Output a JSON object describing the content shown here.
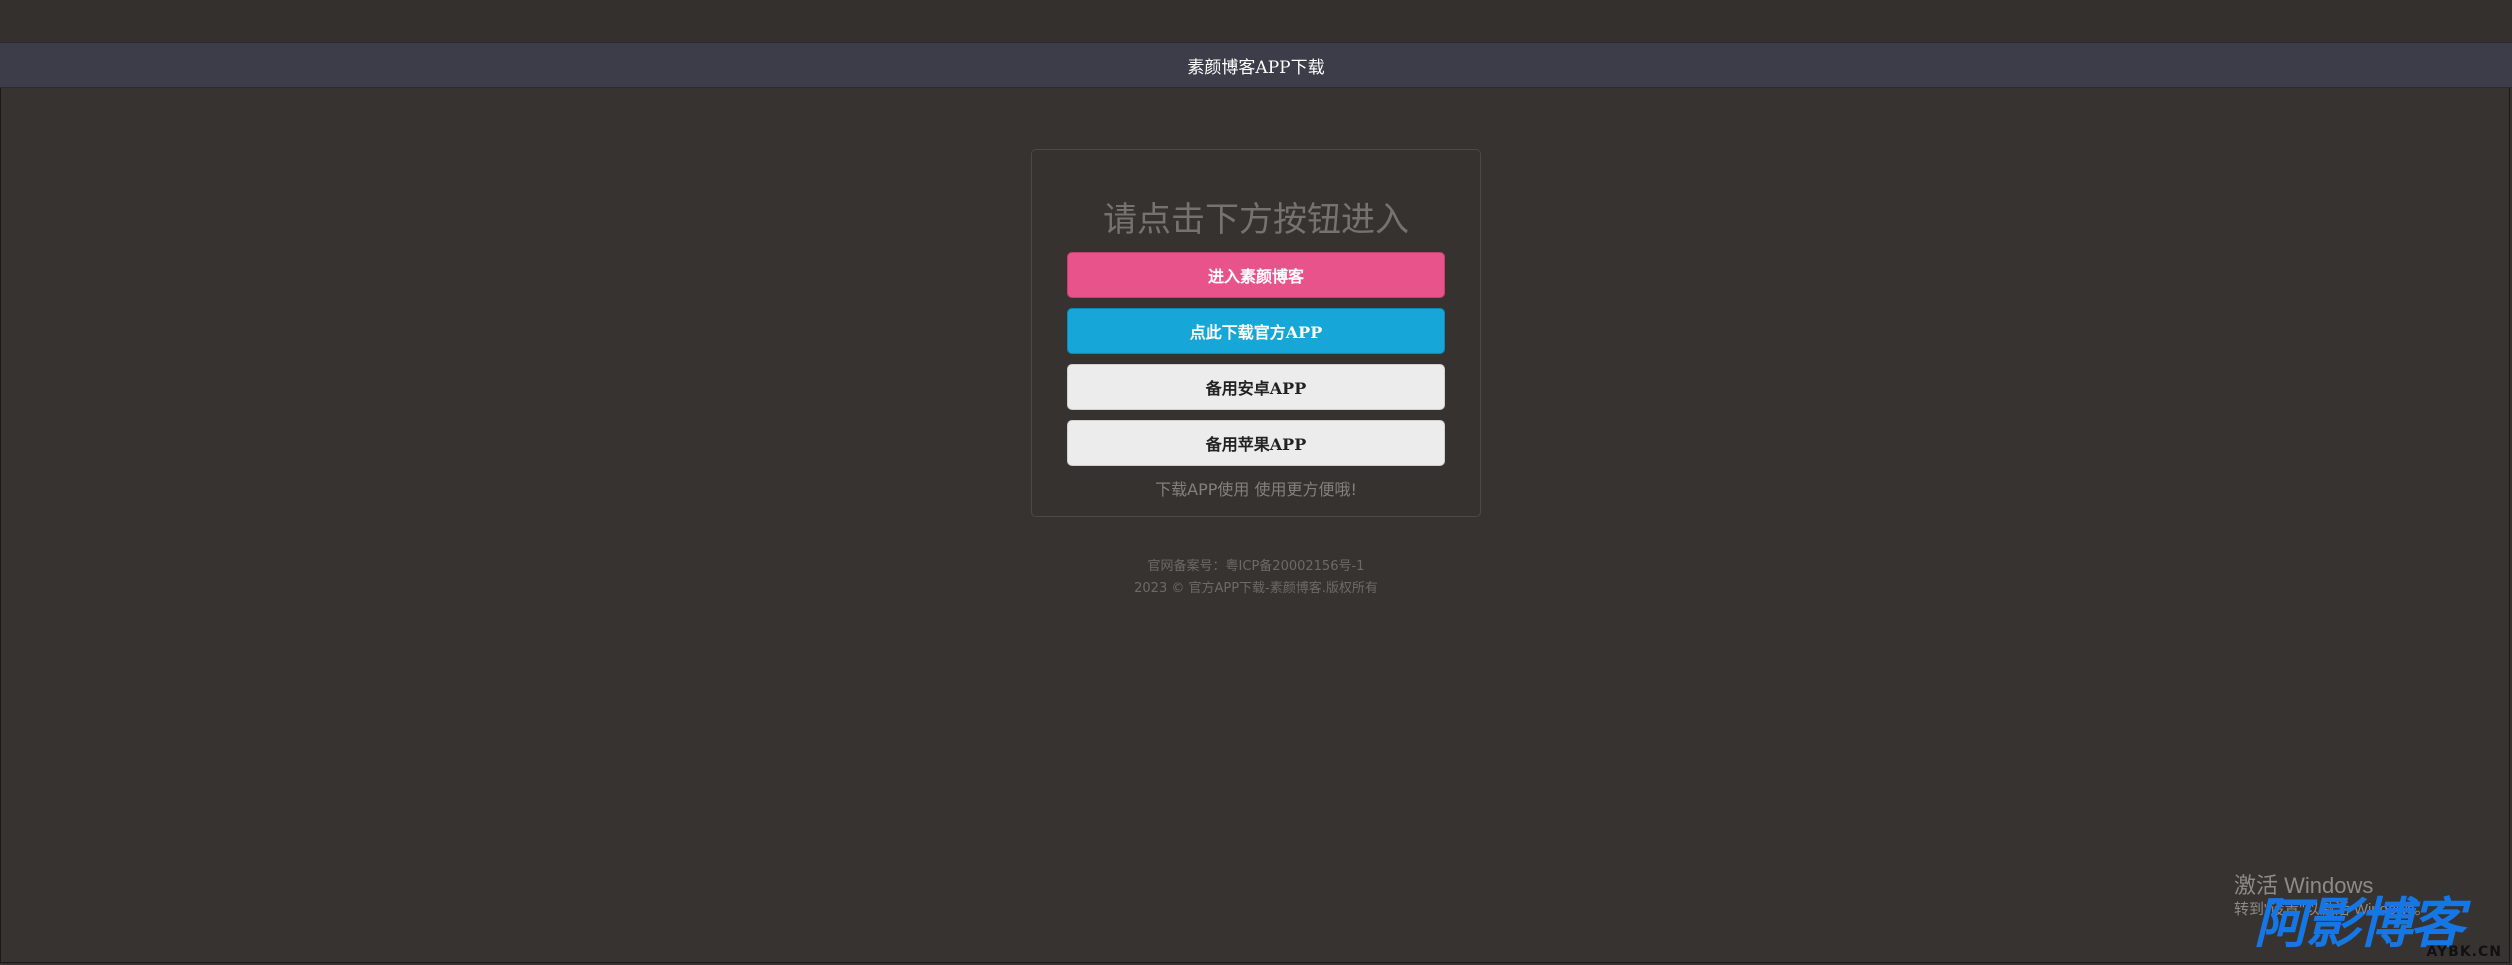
{
  "header": {
    "title": "素颜博客APP下载"
  },
  "card": {
    "heading": "请点击下方按钮进入",
    "buttons": [
      {
        "label": "进入素颜博客",
        "color": "#e9538c"
      },
      {
        "label": "点此下载官方APP",
        "color": "#16a6d7"
      },
      {
        "label": "备用安卓APP",
        "color": "#ececec"
      },
      {
        "label": "备用苹果APP",
        "color": "#ececec"
      }
    ],
    "note": "下载APP使用 使用更方便哦!"
  },
  "footer": {
    "icp": "官网备案号：粤ICP备20002156号-1",
    "copyright": "2023 © 官方APP下载-素颜博客.版权所有"
  },
  "windows_activation": {
    "title": "激活 Windows",
    "subtitle": "转到\"设置\"以激活 Windows。"
  },
  "watermark": {
    "main": "阿影博客",
    "sub": "AYBK.CN"
  }
}
